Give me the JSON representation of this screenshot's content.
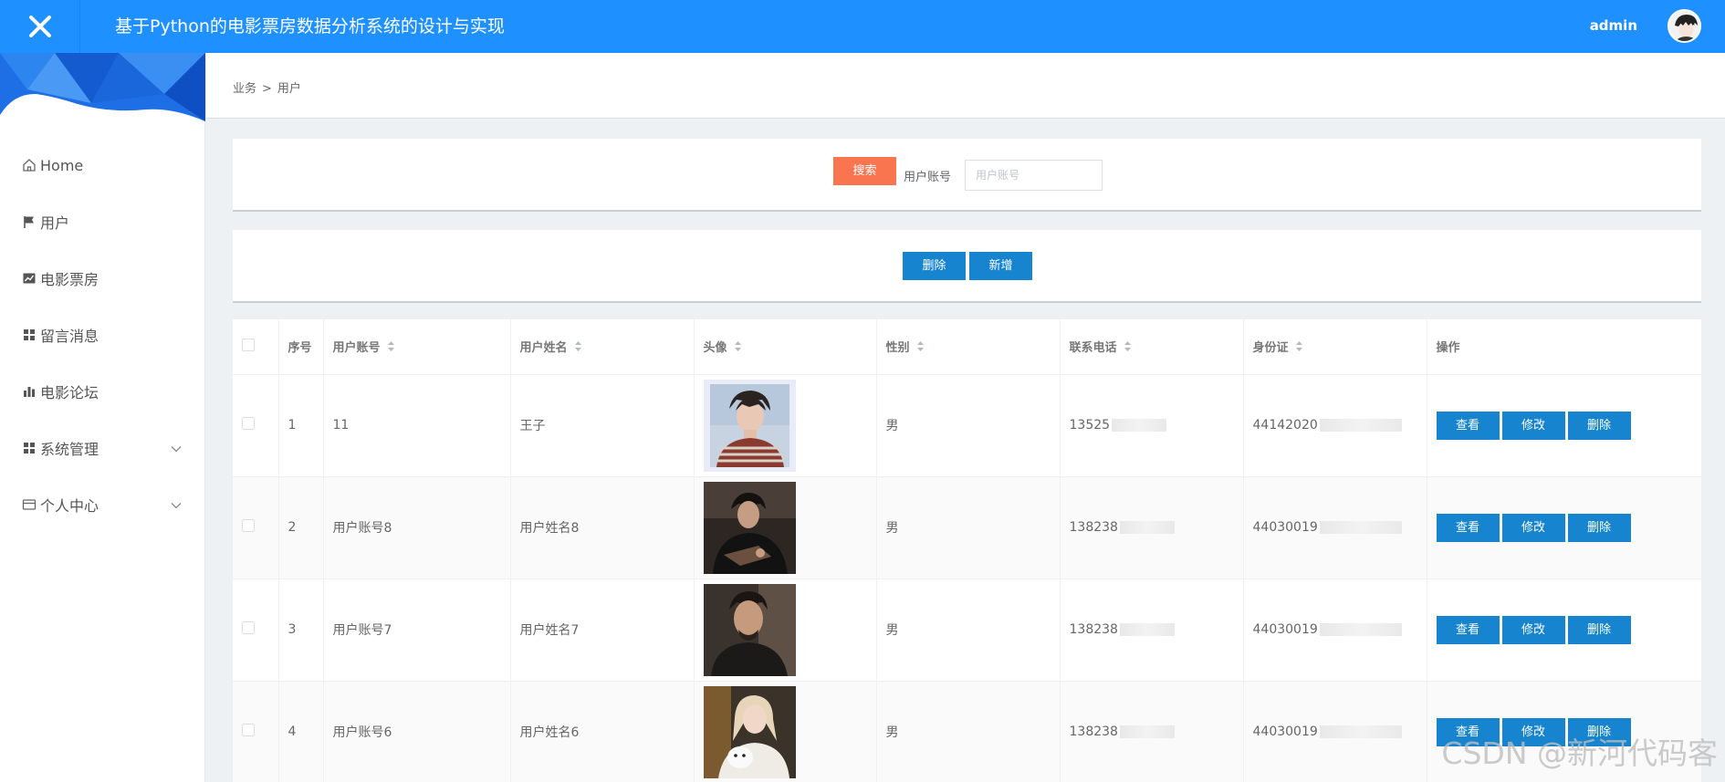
{
  "header": {
    "title": "基于Python的电影票房数据分析系统的设计与实现",
    "username": "admin"
  },
  "sidebar": {
    "items": [
      {
        "label": "Home",
        "icon": "home-icon"
      },
      {
        "label": "用户",
        "icon": "flag-icon"
      },
      {
        "label": "电影票房",
        "icon": "line-chart-icon"
      },
      {
        "label": "留言消息",
        "icon": "grid-icon"
      },
      {
        "label": "电影论坛",
        "icon": "bar-chart-icon"
      },
      {
        "label": "系统管理",
        "icon": "grid-icon",
        "expandable": true
      },
      {
        "label": "个人中心",
        "icon": "card-icon",
        "expandable": true
      }
    ]
  },
  "breadcrumb": {
    "parent": "业务",
    "separator": ">",
    "current": "用户"
  },
  "search": {
    "button_label": "搜索",
    "field_label": "用户账号",
    "placeholder": "用户账号",
    "value": ""
  },
  "actions": {
    "delete_label": "删除",
    "add_label": "新增"
  },
  "table": {
    "headers": {
      "index": "序号",
      "account": "用户账号",
      "name": "用户姓名",
      "avatar": "头像",
      "gender": "性别",
      "phone": "联系电话",
      "id_card": "身份证",
      "ops": "操作"
    },
    "rows": [
      {
        "index": "1",
        "account": "11",
        "name": "王子",
        "gender": "男",
        "phone": "13525",
        "id_card": "44142020"
      },
      {
        "index": "2",
        "account": "用户账号8",
        "name": "用户姓名8",
        "gender": "男",
        "phone": "138238",
        "id_card": "44030019"
      },
      {
        "index": "3",
        "account": "用户账号7",
        "name": "用户姓名7",
        "gender": "男",
        "phone": "138238",
        "id_card": "44030019"
      },
      {
        "index": "4",
        "account": "用户账号6",
        "name": "用户姓名6",
        "gender": "男",
        "phone": "138238",
        "id_card": "44030019"
      }
    ],
    "op_labels": {
      "view": "查看",
      "edit": "修改",
      "delete": "删除"
    }
  },
  "watermark": "CSDN @新河代码客",
  "colors": {
    "header_bg": "#1e90ff",
    "primary_button": "#1784d0",
    "search_button": "#f8754f"
  }
}
